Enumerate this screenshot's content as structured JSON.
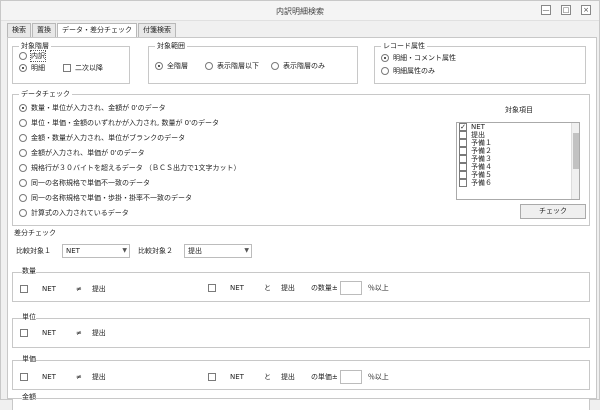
{
  "window": {
    "title": "内訳明細検索",
    "min": "—",
    "max": "□",
    "close": "×"
  },
  "tabs": [
    "検索",
    "置換",
    "データ・差分チェック",
    "付箋検索"
  ],
  "hierarchy": {
    "title": "対象階層",
    "first": "内訳",
    "detail": "明細",
    "second": "二次以降"
  },
  "range": {
    "title": "対象範囲",
    "all": "全階層",
    "below": "表示階層以下",
    "only": "表示階層のみ"
  },
  "record": {
    "title": "レコード属性",
    "comment": "明細・コメント属性",
    "detail_only": "明細属性のみ"
  },
  "data_check": {
    "title": "データチェック",
    "items": [
      "数量・単位が入力され、金額が 0'のデータ",
      "単位・単価・金額のいずれかが入力され, 数量が 0'のデータ",
      "金額・数量が入力され、単位がブランクのデータ",
      "金額が入力され、単価が 0'のデータ",
      "規格行が３０バイトを超えるデータ （ＢＣＳ出力で1文字カット）",
      "同一の名称規格で単価不一致のデータ",
      "同一の名称規格で単価・歩掛・掛率不一致のデータ",
      "計算式の入力されているデータ"
    ],
    "target_label": "対象項目",
    "targets": [
      "NET",
      "提出",
      "予備１",
      "予備２",
      "予備３",
      "予備４",
      "予備５",
      "予備６"
    ],
    "check_mark": "✓",
    "check_button": "チェック"
  },
  "diff": {
    "title": "差分チェック",
    "compare1_label": "比較対象１",
    "compare1_value": "NET",
    "compare2_label": "比較対象２",
    "compare2_value": "提出",
    "quantity": {
      "label": "数量",
      "left": "NET",
      "neq": "≠",
      "right": "提出",
      "left2": "NET",
      "and": "と",
      "right2": "提出",
      "suffix": "の数量±",
      "unit": "％以上"
    },
    "unit": {
      "label": "単位",
      "left": "NET",
      "neq": "≠",
      "right": "提出"
    },
    "price": {
      "label": "単価",
      "left": "NET",
      "neq": "≠",
      "right": "提出",
      "left2": "NET",
      "and": "と",
      "right2": "提出",
      "suffix": "の単価±",
      "unit": "％以上"
    },
    "amount": {
      "label": "金額"
    }
  }
}
